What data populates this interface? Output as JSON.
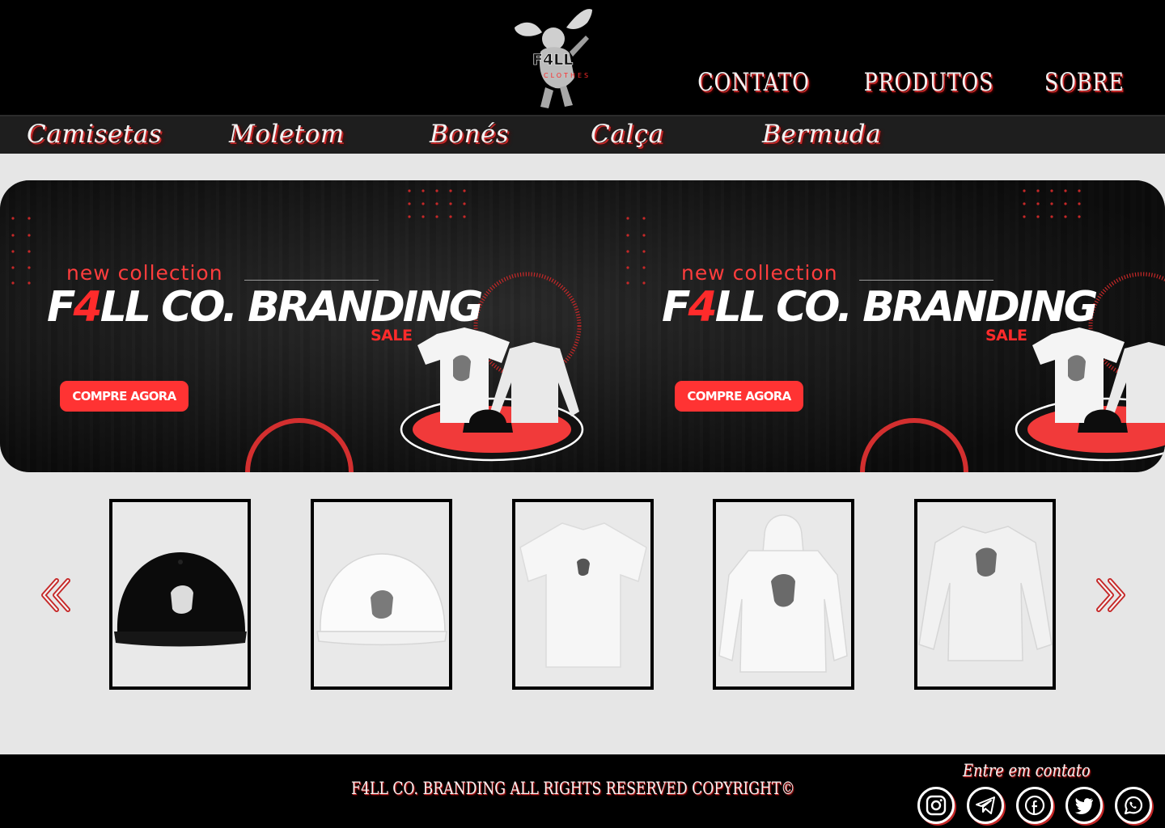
{
  "header": {
    "logo_text": "F4LL",
    "logo_subtext": "CLOTHES",
    "nav": [
      "CONTATO",
      "PRODUTOS",
      "SOBRE"
    ]
  },
  "categories": [
    "Camisetas",
    "Moletom",
    "Bonés",
    "Calça",
    "Bermuda"
  ],
  "banner": {
    "slides": [
      {
        "kicker": "new collection",
        "brand_prefix": "F",
        "brand_accent": "4",
        "brand_suffix": "LL CO. BRANDING",
        "sale": "SALE",
        "cta": "COMPRE AGORA"
      },
      {
        "kicker": "new collection",
        "brand_prefix": "F",
        "brand_accent": "4",
        "brand_suffix": "LL CO. BRANDING",
        "sale": "SALE",
        "cta": "COMPRE AGORA"
      }
    ]
  },
  "carousel": {
    "prev_icon": "double-chevron-left-icon",
    "next_icon": "double-chevron-right-icon",
    "products": [
      {
        "name": "black-snapback-cap",
        "color": "#000000"
      },
      {
        "name": "white-snapback-cap",
        "color": "#ffffff"
      },
      {
        "name": "white-t-shirt",
        "color": "#ffffff"
      },
      {
        "name": "white-hoodie",
        "color": "#ffffff"
      },
      {
        "name": "white-long-sleeve",
        "color": "#ffffff"
      }
    ]
  },
  "footer": {
    "copyright": "F4LL CO. BRANDING ALL RIGHTS RESERVED COPYRIGHT©",
    "contact_label": "Entre em contato",
    "social": [
      "instagram-icon",
      "telegram-icon",
      "facebook-icon",
      "twitter-icon",
      "whatsapp-icon"
    ]
  },
  "colors": {
    "accent": "#ff3333",
    "header_bg": "#000000",
    "catbar_bg": "#1e1e1e",
    "page_bg": "#e6e6e6"
  }
}
